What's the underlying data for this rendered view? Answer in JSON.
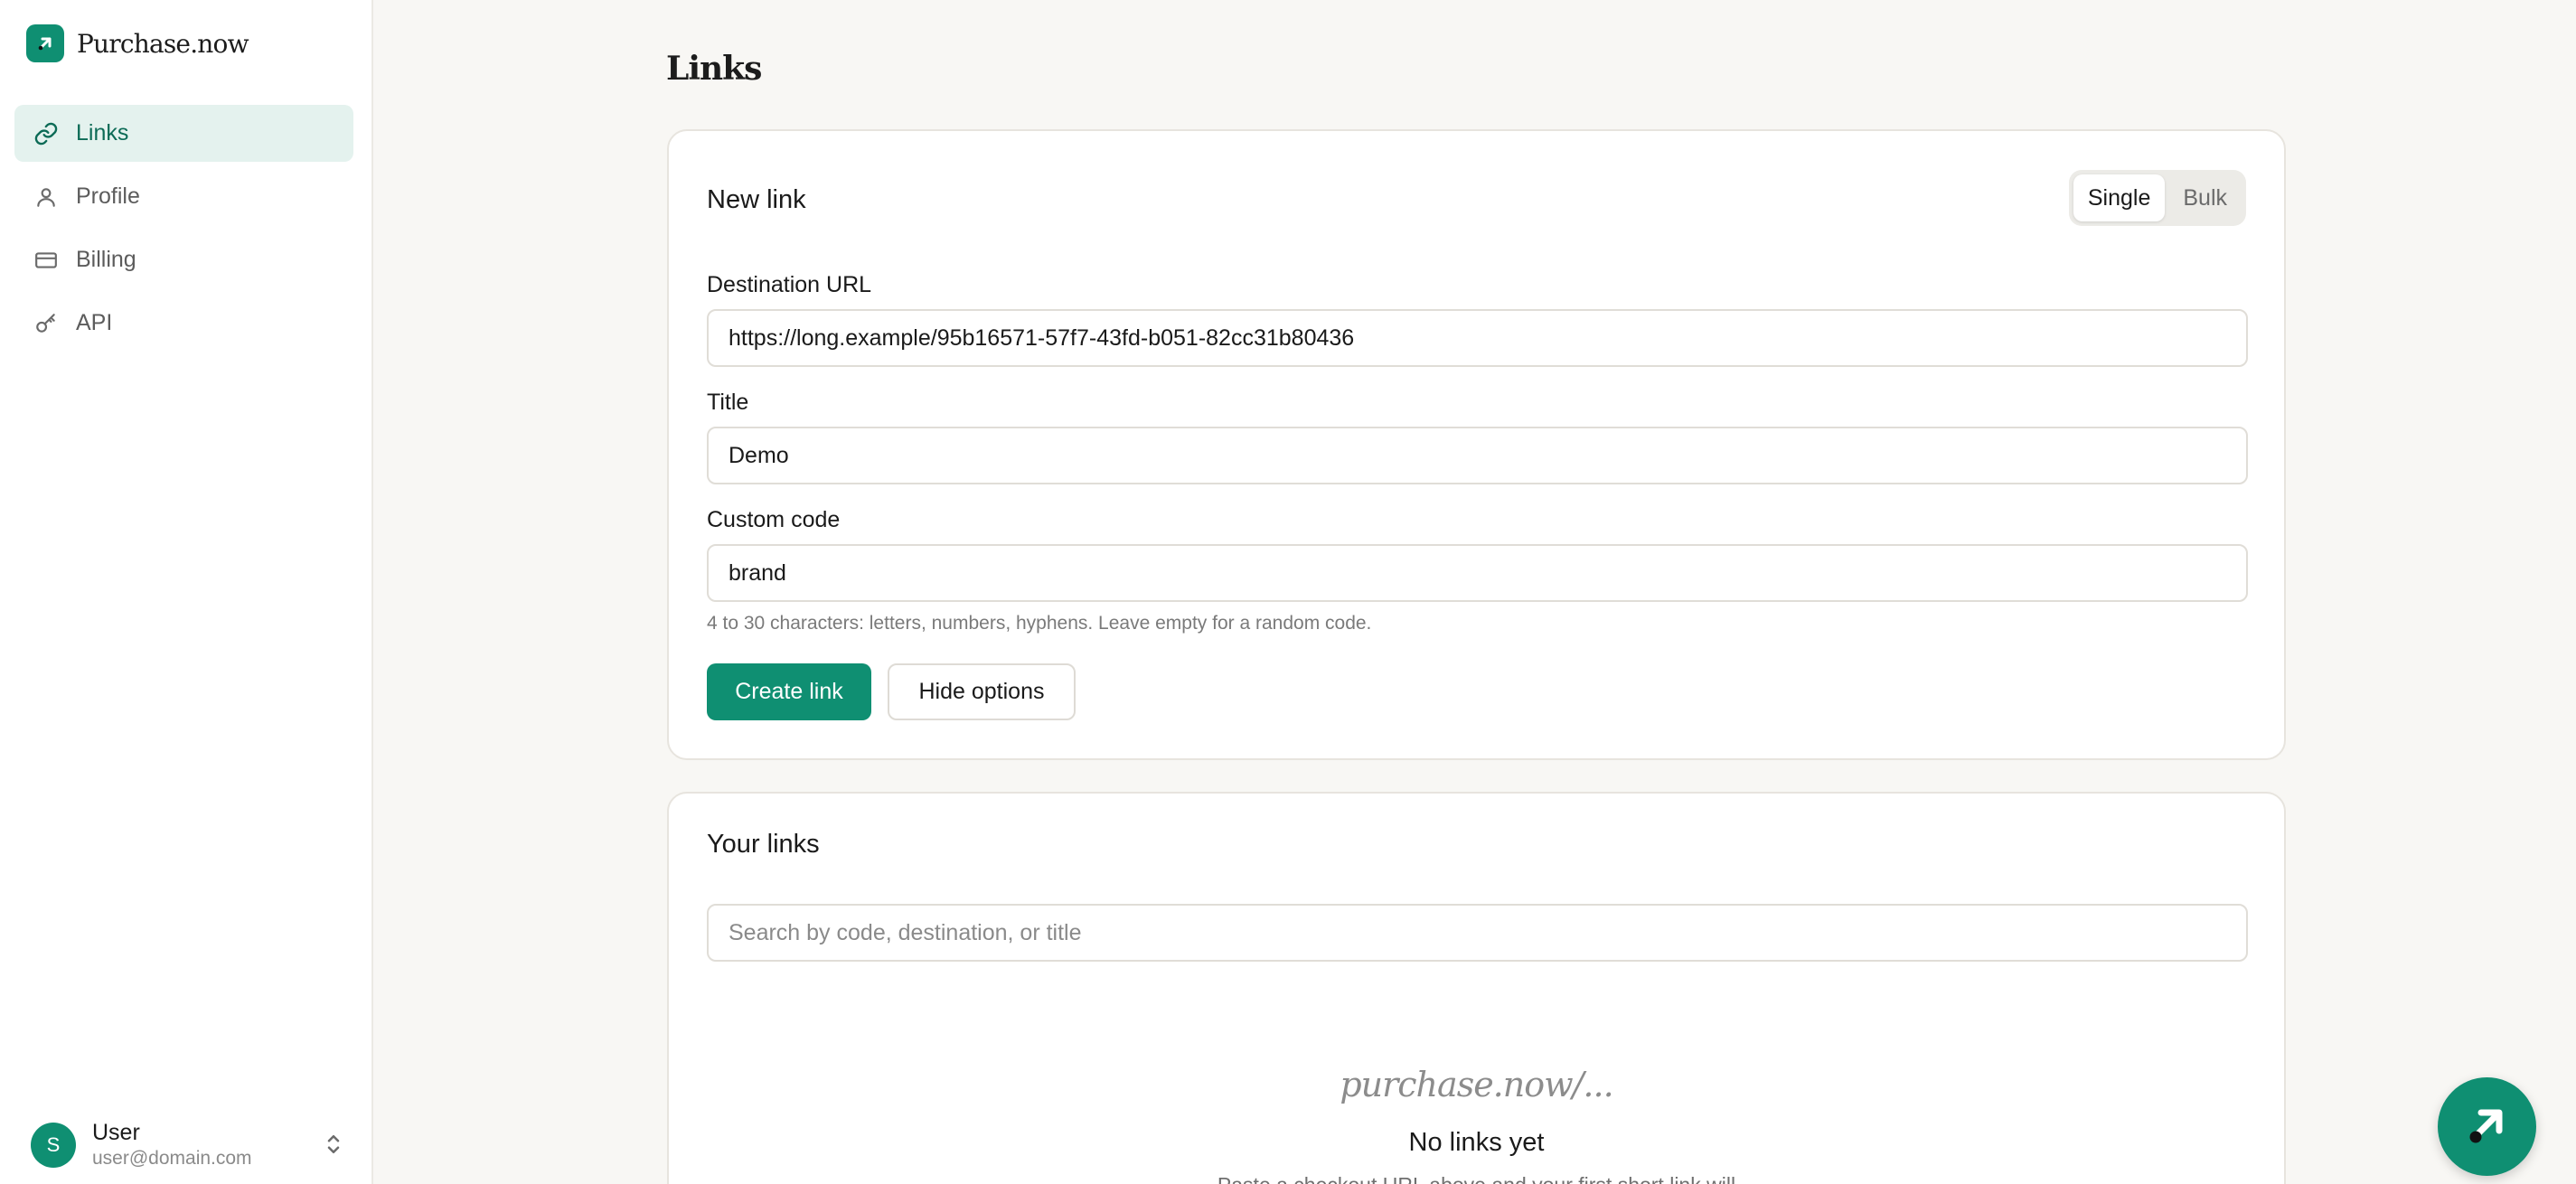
{
  "app": {
    "name": "Purchase.now",
    "logo_icon": "arrow-up-right-icon",
    "accent": "#0f8f72"
  },
  "sidebar": {
    "items": [
      {
        "label": "Links",
        "icon": "link-icon",
        "active": true
      },
      {
        "label": "Profile",
        "icon": "user-icon",
        "active": false
      },
      {
        "label": "Billing",
        "icon": "credit-card-icon",
        "active": false
      },
      {
        "label": "API",
        "icon": "key-icon",
        "active": false
      }
    ],
    "user": {
      "initial": "S",
      "name": "User",
      "email": "user@domain.com"
    }
  },
  "main": {
    "title": "Links",
    "new_link": {
      "title": "New link",
      "mode_tabs": [
        "Single",
        "Bulk"
      ],
      "selected_mode": "Single",
      "destination": {
        "label": "Destination URL",
        "value": "https://long.example/95b16571-57f7-43fd-b051-82cc31b80436"
      },
      "title_field": {
        "label": "Title",
        "value": "Demo"
      },
      "custom_code": {
        "label": "Custom code",
        "value": "brand"
      },
      "hint": "4 to 30 characters: letters, numbers, hyphens. Leave empty for a random code.",
      "create_label": "Create link",
      "hide_options_label": "Hide options"
    },
    "your_links": {
      "title": "Your links",
      "search_placeholder": "Search by code, destination, or title",
      "empty_hero": "purchase.now/...",
      "empty_title": "No links yet",
      "empty_sub": "Paste a checkout URL above and your first short link will"
    }
  }
}
